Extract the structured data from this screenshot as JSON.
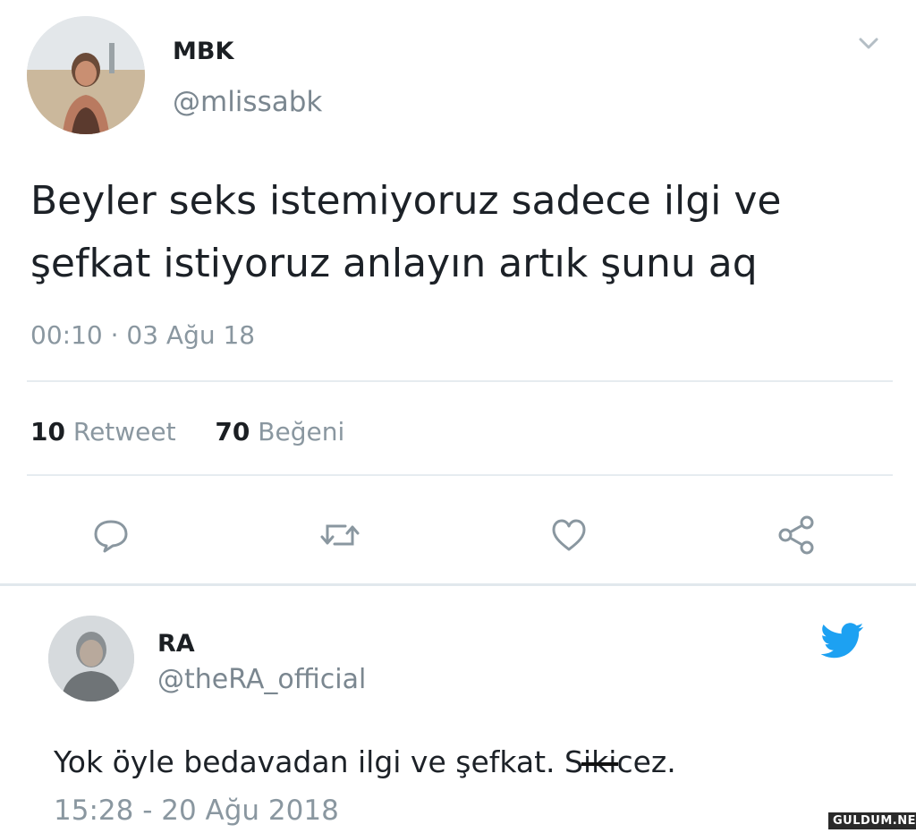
{
  "tweet": {
    "display_name": "MBK",
    "handle": "@mlissabk",
    "text": "Beyler seks istemiyoruz sadece ilgi ve şefkat istiyoruz anlayın artık şunu aq",
    "timestamp": "00:10 · 03 Ağu 18",
    "retweet_count": "10",
    "retweet_label": "Retweet",
    "like_count": "70",
    "like_label": "Beğeni",
    "actions": [
      "reply-icon",
      "retweet-icon",
      "like-icon",
      "share-icon"
    ],
    "menu_icon": "chevron-down-icon"
  },
  "reply": {
    "display_name": "RA",
    "handle": "@theRA_official",
    "text_before": "Yok öyle bedavadan ilgi ve şefkat. S",
    "text_censored": "iki",
    "text_after": "cez.",
    "timestamp": "15:28 - 20 Ağu 2018",
    "source_icon": "twitter-bird-icon"
  },
  "watermark": "GULDUM.NET",
  "colors": {
    "text_primary": "#14171a",
    "text_secondary": "#8a97a0",
    "divider": "#e6ecf0",
    "twitter_blue": "#1da1f2"
  }
}
